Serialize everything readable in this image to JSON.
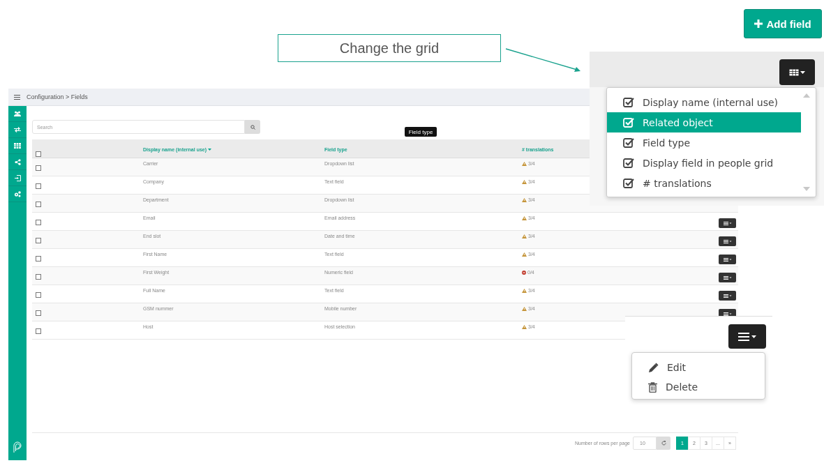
{
  "add_button": {
    "label": "Add field"
  },
  "callout": {
    "text": "Change the grid"
  },
  "header": {
    "breadcrumb": "Configuration > Fields"
  },
  "search": {
    "placeholder": "Search"
  },
  "tooltip": {
    "text": "Field type"
  },
  "table": {
    "select_all": {
      "checked": false
    },
    "columns": [
      {
        "label": "Display name (internal use)",
        "sorted": true
      },
      {
        "label": "Field type",
        "sorted": false
      },
      {
        "label": "# translations",
        "sorted": false
      }
    ],
    "rows": [
      {
        "checked": false,
        "name": "Carrier",
        "type": "Dropdown list",
        "kind": "warning",
        "translations": "3/4",
        "menu_button": false
      },
      {
        "checked": false,
        "name": "Company",
        "type": "Text field",
        "kind": "warning",
        "translations": "3/4",
        "menu_button": false
      },
      {
        "checked": false,
        "name": "Department",
        "type": "Dropdown list",
        "kind": "warning",
        "translations": "3/4",
        "menu_button": false
      },
      {
        "checked": false,
        "name": "Email",
        "type": "Email address",
        "kind": "warning",
        "translations": "3/4",
        "menu_button": true
      },
      {
        "checked": false,
        "name": "End slot",
        "type": "Date and time",
        "kind": "warning",
        "translations": "3/4",
        "menu_button": true
      },
      {
        "checked": false,
        "name": "First Name",
        "type": "Text field",
        "kind": "warning",
        "translations": "3/4",
        "menu_button": true
      },
      {
        "checked": false,
        "name": "First Weight",
        "type": "Numeric field",
        "kind": "error",
        "translations": "0/4",
        "menu_button": true
      },
      {
        "checked": false,
        "name": "Full Name",
        "type": "Text field",
        "kind": "warning",
        "translations": "3/4",
        "menu_button": true
      },
      {
        "checked": false,
        "name": "GSM nummer",
        "type": "Mobile number",
        "kind": "warning",
        "translations": "3/4",
        "menu_button": true
      },
      {
        "checked": false,
        "name": "Host",
        "type": "Host selection",
        "kind": "warning",
        "translations": "3/4",
        "menu_button": false
      }
    ]
  },
  "pagination": {
    "rows_label": "Number of rows per page",
    "rows_value": "10",
    "pages": [
      {
        "label": "1",
        "selected": true
      },
      {
        "label": "2",
        "selected": false
      },
      {
        "label": "3",
        "selected": false
      },
      {
        "label": "...",
        "selected": false
      },
      {
        "label": "»",
        "selected": false
      }
    ]
  },
  "column_menu": {
    "items": [
      {
        "label": "Display name (internal use)",
        "checked": true,
        "selected": false
      },
      {
        "label": "Related object",
        "checked": true,
        "selected": true
      },
      {
        "label": "Field type",
        "checked": true,
        "selected": false
      },
      {
        "label": "Display field in people grid",
        "checked": true,
        "selected": false
      },
      {
        "label": "# translations",
        "checked": true,
        "selected": false
      }
    ]
  },
  "row_menu": {
    "items": [
      {
        "kind": "edit",
        "label": "Edit"
      },
      {
        "kind": "delete",
        "label": "Delete"
      }
    ]
  }
}
